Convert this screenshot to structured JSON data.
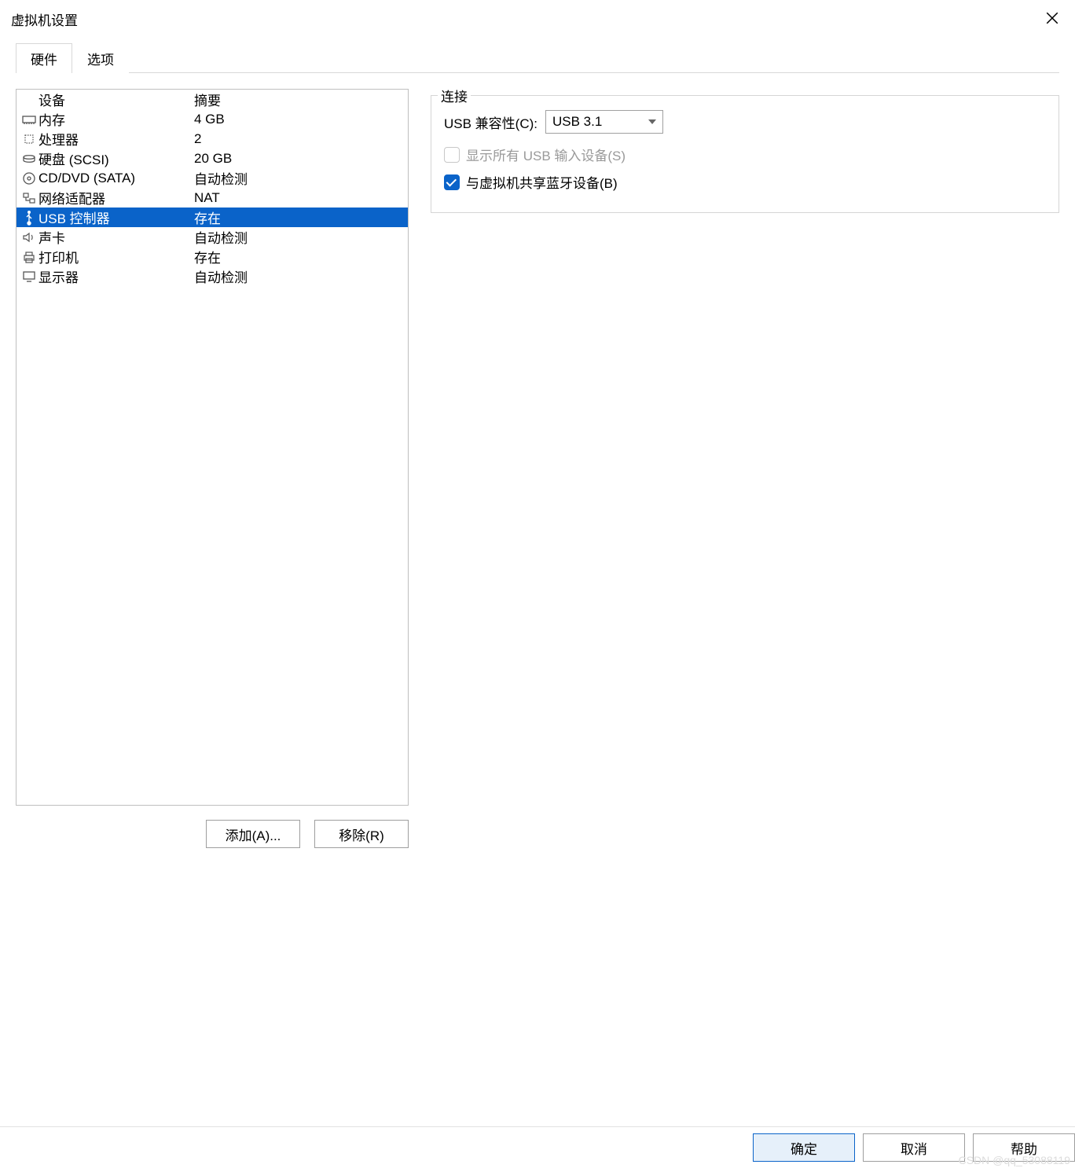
{
  "window": {
    "title": "虚拟机设置"
  },
  "tabs": {
    "hardware": "硬件",
    "options": "选项",
    "active": "hardware"
  },
  "hardware": {
    "headers": {
      "device": "设备",
      "summary": "摘要"
    },
    "rows": [
      {
        "icon": "memory-icon",
        "device": "内存",
        "summary": "4 GB"
      },
      {
        "icon": "cpu-icon",
        "device": "处理器",
        "summary": "2"
      },
      {
        "icon": "disk-icon",
        "device": "硬盘 (SCSI)",
        "summary": "20 GB"
      },
      {
        "icon": "cd-icon",
        "device": "CD/DVD (SATA)",
        "summary": "自动检测"
      },
      {
        "icon": "network-icon",
        "device": "网络适配器",
        "summary": "NAT"
      },
      {
        "icon": "usb-icon",
        "device": "USB 控制器",
        "summary": "存在",
        "selected": true
      },
      {
        "icon": "sound-icon",
        "device": "声卡",
        "summary": "自动检测"
      },
      {
        "icon": "printer-icon",
        "device": "打印机",
        "summary": "存在"
      },
      {
        "icon": "display-icon",
        "device": "显示器",
        "summary": "自动检测"
      }
    ],
    "add_button": "添加(A)...",
    "remove_button": "移除(R)"
  },
  "right": {
    "group_title": "连接",
    "compat_label": "USB 兼容性(C):",
    "compat_value": "USB 3.1",
    "show_all_label": "显示所有 USB 输入设备(S)",
    "show_all_checked": false,
    "show_all_disabled": true,
    "share_bt_label": "与虚拟机共享蓝牙设备(B)",
    "share_bt_checked": true
  },
  "footer": {
    "ok": "确定",
    "cancel": "取消",
    "help": "帮助"
  },
  "watermark": "CSDN @qq_53088119"
}
